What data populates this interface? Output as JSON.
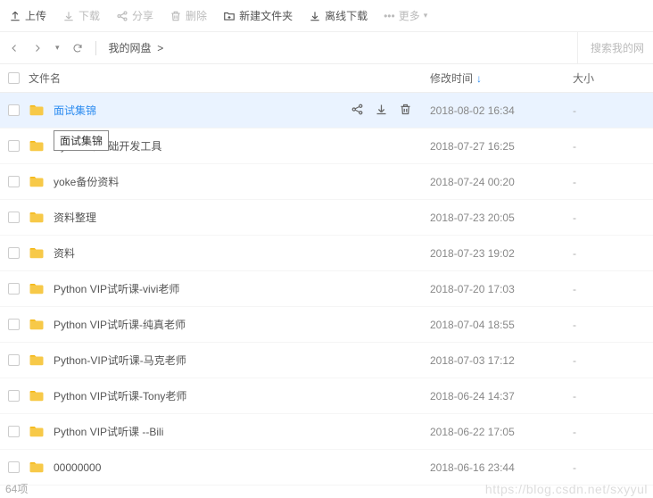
{
  "toolbar": {
    "upload": "上传",
    "download": "下载",
    "share": "分享",
    "delete": "删除",
    "new_folder": "新建文件夹",
    "offline_download": "离线下载",
    "more": "更多"
  },
  "nav": {
    "breadcrumb_root": "我的网盘",
    "breadcrumb_sep": ">",
    "search_placeholder": "搜索我的网"
  },
  "columns": {
    "name": "文件名",
    "time": "修改时间",
    "size": "大小"
  },
  "tooltip": "面试集锦",
  "files": [
    {
      "name": "面试集锦",
      "time": "2018-08-02 16:34",
      "size": "-",
      "selected": true
    },
    {
      "name": "Python零基础开发工具",
      "time": "2018-07-27 16:25",
      "size": "-",
      "selected": false
    },
    {
      "name": "yoke备份资料",
      "time": "2018-07-24 00:20",
      "size": "-",
      "selected": false
    },
    {
      "name": "资料整理",
      "time": "2018-07-23 20:05",
      "size": "-",
      "selected": false
    },
    {
      "name": "资料",
      "time": "2018-07-23 19:02",
      "size": "-",
      "selected": false
    },
    {
      "name": "Python VIP试听课-vivi老师",
      "time": "2018-07-20 17:03",
      "size": "-",
      "selected": false
    },
    {
      "name": "Python VIP试听课-纯真老师",
      "time": "2018-07-04 18:55",
      "size": "-",
      "selected": false
    },
    {
      "name": "Python-VIP试听课-马克老师",
      "time": "2018-07-03 17:12",
      "size": "-",
      "selected": false
    },
    {
      "name": "Python VIP试听课-Tony老师",
      "time": "2018-06-24 14:37",
      "size": "-",
      "selected": false
    },
    {
      "name": "Python VIP试听课 --Bili",
      "time": "2018-06-22 17:05",
      "size": "-",
      "selected": false
    },
    {
      "name": "00000000",
      "time": "2018-06-16 23:44",
      "size": "-",
      "selected": false
    }
  ],
  "footer": {
    "count": "64项"
  },
  "watermark": "https://blog.csdn.net/sxyyul"
}
